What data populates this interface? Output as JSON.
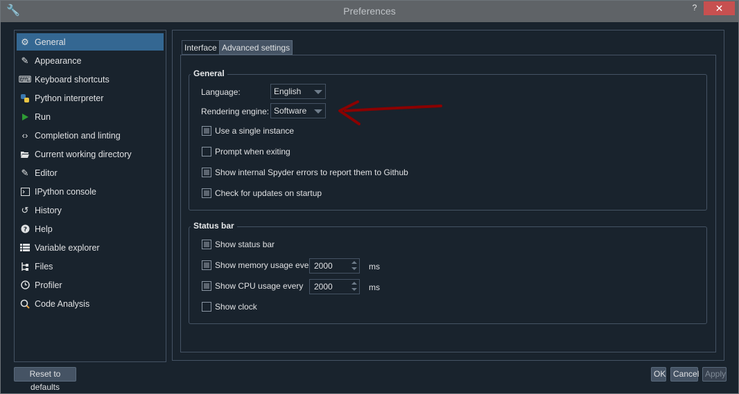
{
  "window": {
    "title": "Preferences",
    "help_label": "?",
    "close_label": "✕",
    "icon": "wrench-icon"
  },
  "sidebar": {
    "items": [
      {
        "label": "General",
        "icon": "gears-icon",
        "active": true
      },
      {
        "label": "Appearance",
        "icon": "eyedropper-icon"
      },
      {
        "label": "Keyboard shortcuts",
        "icon": "keyboard-icon"
      },
      {
        "label": "Python interpreter",
        "icon": "python-icon"
      },
      {
        "label": "Run",
        "icon": "play-icon"
      },
      {
        "label": "Completion and linting",
        "icon": "code-icon"
      },
      {
        "label": "Current working directory",
        "icon": "folder-open-icon"
      },
      {
        "label": "Editor",
        "icon": "edit-icon"
      },
      {
        "label": "IPython console",
        "icon": "terminal-icon"
      },
      {
        "label": "History",
        "icon": "history-icon"
      },
      {
        "label": "Help",
        "icon": "question-icon"
      },
      {
        "label": "Variable explorer",
        "icon": "table-icon"
      },
      {
        "label": "Files",
        "icon": "file-tree-icon"
      },
      {
        "label": "Profiler",
        "icon": "clock-icon"
      },
      {
        "label": "Code Analysis",
        "icon": "search-bug-icon"
      }
    ]
  },
  "tabs": [
    {
      "label": "Interface",
      "selected": false
    },
    {
      "label": "Advanced settings",
      "selected": true
    }
  ],
  "general": {
    "title": "General",
    "language_label": "Language:",
    "language_value": "English",
    "engine_label": "Rendering engine:",
    "engine_value": "Software",
    "checkboxes": [
      {
        "label": "Use a single instance",
        "checked": true
      },
      {
        "label": "Prompt when exiting",
        "checked": false
      },
      {
        "label": "Show internal Spyder errors to report them to Github",
        "checked": true
      },
      {
        "label": "Check for updates on startup",
        "checked": true
      }
    ]
  },
  "status_bar": {
    "title": "Status bar",
    "show_status_bar": {
      "label": "Show status bar",
      "checked": true
    },
    "memory": {
      "label": "Show memory usage every",
      "checked": true,
      "value": "2000",
      "unit": "ms"
    },
    "cpu": {
      "label": "Show CPU usage every",
      "checked": true,
      "value": "2000",
      "unit": "ms"
    },
    "clock": {
      "label": "Show clock",
      "checked": false
    }
  },
  "footer": {
    "reset_label": "Reset to defaults",
    "ok_label": "OK",
    "cancel_label": "Cancel",
    "apply_label": "Apply"
  },
  "colors": {
    "background": "#19232d",
    "selection": "#346792",
    "border": "#455364",
    "annotation_arrow": "#8b0000"
  }
}
